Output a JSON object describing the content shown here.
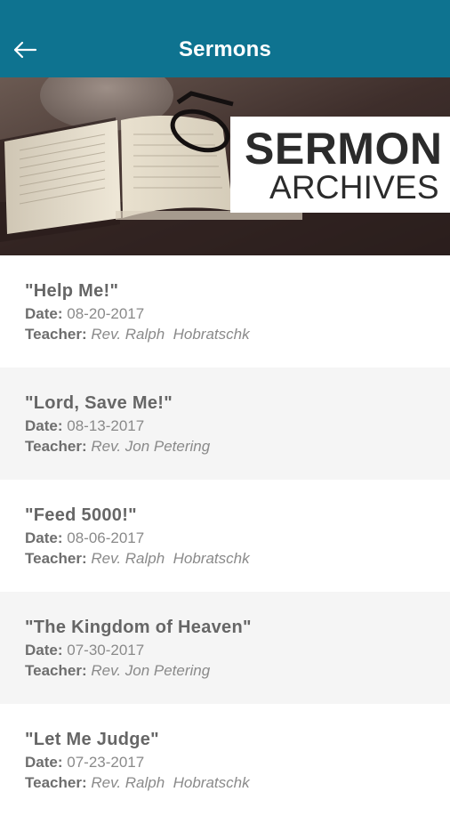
{
  "app_bar": {
    "title": "Sermons",
    "back_icon": "arrow-left-icon",
    "color": "#0e7390"
  },
  "banner": {
    "title": "SERMON",
    "subtitle": "ARCHIVES"
  },
  "labels": {
    "date": "Date:",
    "teacher": "Teacher:"
  },
  "sermons": [
    {
      "title": "\"Help Me!\"",
      "date": "08-20-2017",
      "teacher": "Rev. Ralph  Hobratschk"
    },
    {
      "title": "\"Lord, Save Me!\"",
      "date": "08-13-2017",
      "teacher": "Rev. Jon Petering"
    },
    {
      "title": "\"Feed 5000!\"",
      "date": "08-06-2017",
      "teacher": "Rev. Ralph  Hobratschk"
    },
    {
      "title": "\"The Kingdom of Heaven\"",
      "date": "07-30-2017",
      "teacher": "Rev. Jon Petering"
    },
    {
      "title": "\"Let Me Judge\"",
      "date": "07-23-2017",
      "teacher": "Rev. Ralph  Hobratschk"
    }
  ]
}
